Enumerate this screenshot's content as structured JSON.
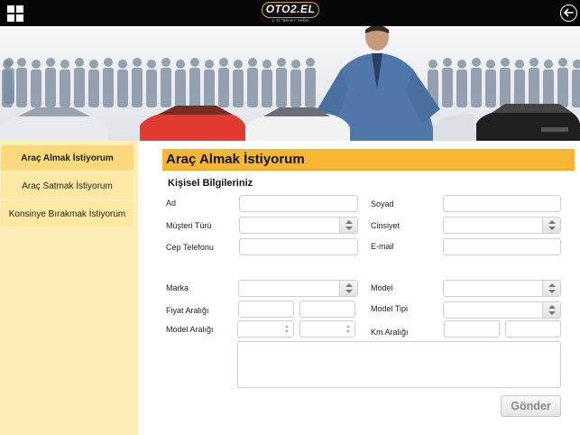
{
  "header": {
    "logo_text": "OTO2.EL",
    "logo_tagline": "2. El ''Bilinen'' Hekim"
  },
  "sidebar": {
    "items": [
      {
        "label": "Araç Almak İstiyorum"
      },
      {
        "label": "Araç Satmak İstiyorum"
      },
      {
        "label": "Konsinye Bırakmak İstiyorum"
      }
    ]
  },
  "form": {
    "title": "Araç Almak İstiyorum",
    "subtitle": "Kişisel Bilgileriniz",
    "labels": {
      "ad": "Ad",
      "soyad": "Soyad",
      "musteri_turu": "Müşteri Türü",
      "cinsiyet": "Cinsiyet",
      "cep_telefonu": "Cep Telefonu",
      "email": "E-mail",
      "marka": "Marka",
      "model": "Model",
      "fiyat_araligi": "Fiyat Aralığı",
      "model_tipi": "Model Tipi",
      "model_araligi": "Model Aralığı",
      "km_araligi": "Km Aralığı"
    },
    "send_label": "Gönder"
  },
  "colors": {
    "accent": "#f7b733",
    "sidebar_bg": "#fdeeb8",
    "sidebar_active": "#fbd97c",
    "topbar": "#060606"
  }
}
